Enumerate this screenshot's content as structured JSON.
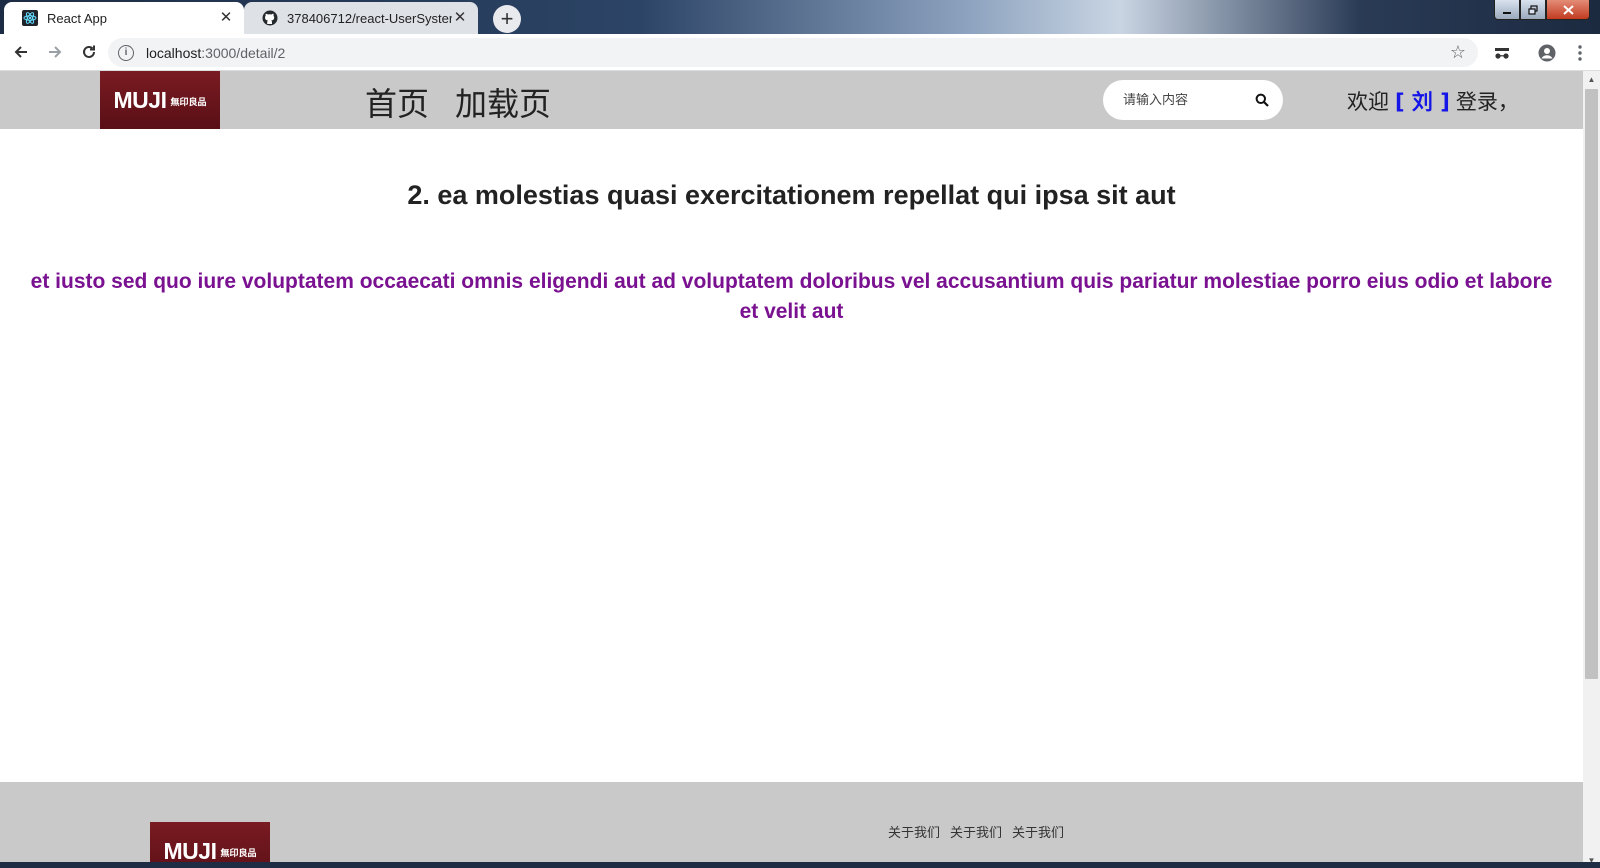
{
  "browser": {
    "tabs": [
      {
        "title": "React App",
        "active": true,
        "icon": "react-icon"
      },
      {
        "title": "378406712/react-UserSystem",
        "active": false,
        "icon": "github-icon"
      }
    ],
    "close_glyph": "✕",
    "new_tab_glyph": "+",
    "url_host": "localhost",
    "url_path": ":3000/detail/2"
  },
  "header": {
    "logo_text": "MUJI",
    "logo_sub": "無印良品",
    "nav": [
      {
        "label": "首页"
      },
      {
        "label": "加载页"
      }
    ],
    "search_placeholder": "请输入内容",
    "welcome_prefix": "欢迎",
    "welcome_user": "[ 刘 ]",
    "welcome_suffix": "登录，"
  },
  "detail": {
    "title": "2. ea molestias quasi exercitationem repellat qui ipsa sit aut",
    "body": "et iusto sed quo iure voluptatem occaecati omnis eligendi aut ad voluptatem doloribus vel accusantium quis pariatur molestiae porro eius odio et labore et velit aut"
  },
  "footer": {
    "logo_text": "MUJI",
    "logo_sub": "無印良品",
    "links": [
      {
        "label": "关于我们"
      },
      {
        "label": "关于我们"
      },
      {
        "label": "关于我们"
      }
    ]
  },
  "colors": {
    "header_bg": "#c9c9c9",
    "logo_bg": "#6b151c",
    "body_text": "#7a1191",
    "user_link": "#1515e8"
  }
}
